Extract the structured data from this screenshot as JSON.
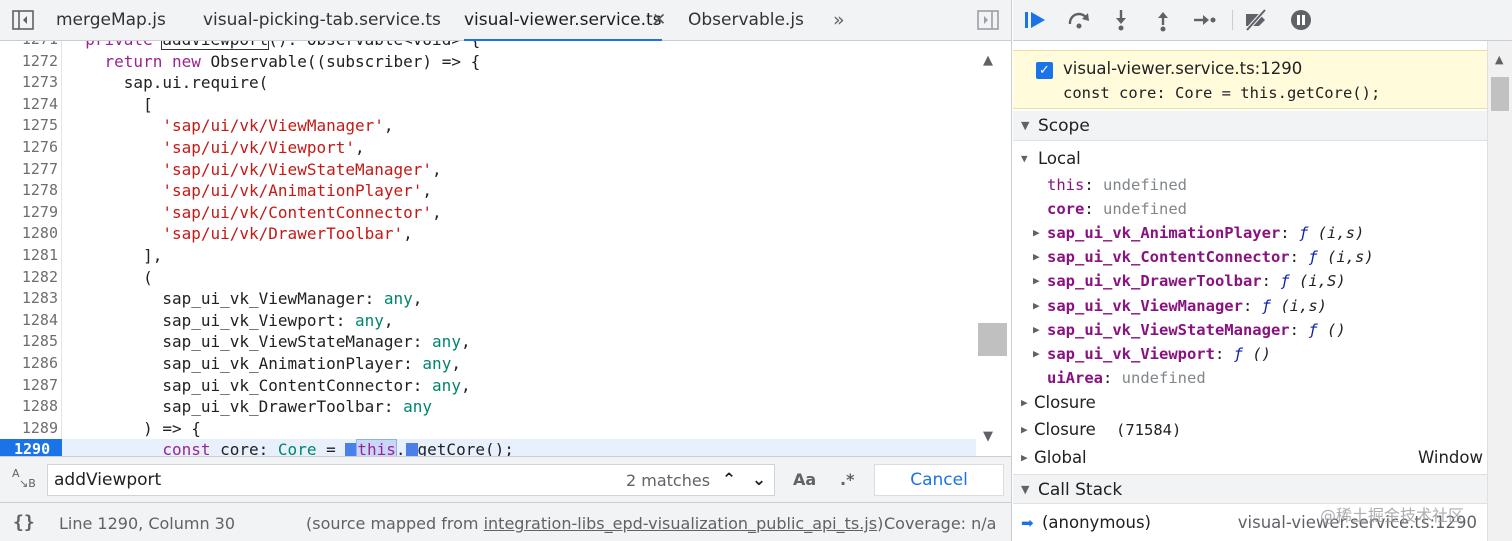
{
  "tabs": [
    {
      "label": "mergeMap.js"
    },
    {
      "label": "visual-picking-tab.service.ts"
    },
    {
      "label": "visual-viewer.service.ts"
    },
    {
      "label": "Observable.js"
    }
  ],
  "tab_close": "✕",
  "tab_more": "»",
  "code": {
    "lines": [
      {
        "n": "1271",
        "segs": [
          {
            "t": "  "
          },
          {
            "t": "private ",
            "c": "kw"
          },
          {
            "t": "addViewport",
            "c": "hlbox"
          },
          {
            "t": "(): Observable<void> {"
          }
        ]
      },
      {
        "n": "1272",
        "segs": [
          {
            "t": "    "
          },
          {
            "t": "return new ",
            "c": "kw"
          },
          {
            "t": "Observable((subscriber) => {"
          }
        ]
      },
      {
        "n": "1273",
        "segs": [
          {
            "t": "      sap.ui.require("
          }
        ]
      },
      {
        "n": "1274",
        "segs": [
          {
            "t": "        ["
          }
        ]
      },
      {
        "n": "1275",
        "segs": [
          {
            "t": "          "
          },
          {
            "t": "'sap/ui/vk/ViewManager'",
            "c": "str"
          },
          {
            "t": ","
          }
        ]
      },
      {
        "n": "1276",
        "segs": [
          {
            "t": "          "
          },
          {
            "t": "'sap/ui/vk/Viewport'",
            "c": "str"
          },
          {
            "t": ","
          }
        ]
      },
      {
        "n": "1277",
        "segs": [
          {
            "t": "          "
          },
          {
            "t": "'sap/ui/vk/ViewStateManager'",
            "c": "str"
          },
          {
            "t": ","
          }
        ]
      },
      {
        "n": "1278",
        "segs": [
          {
            "t": "          "
          },
          {
            "t": "'sap/ui/vk/AnimationPlayer'",
            "c": "str"
          },
          {
            "t": ","
          }
        ]
      },
      {
        "n": "1279",
        "segs": [
          {
            "t": "          "
          },
          {
            "t": "'sap/ui/vk/ContentConnector'",
            "c": "str"
          },
          {
            "t": ","
          }
        ]
      },
      {
        "n": "1280",
        "segs": [
          {
            "t": "          "
          },
          {
            "t": "'sap/ui/vk/DrawerToolbar'",
            "c": "str"
          },
          {
            "t": ","
          }
        ]
      },
      {
        "n": "1281",
        "segs": [
          {
            "t": "        ],"
          }
        ]
      },
      {
        "n": "1282",
        "segs": [
          {
            "t": "        ("
          }
        ]
      },
      {
        "n": "1283",
        "segs": [
          {
            "t": "          sap_ui_vk_ViewManager: "
          },
          {
            "t": "any",
            "c": "ty"
          },
          {
            "t": ","
          }
        ]
      },
      {
        "n": "1284",
        "segs": [
          {
            "t": "          sap_ui_vk_Viewport: "
          },
          {
            "t": "any",
            "c": "ty"
          },
          {
            "t": ","
          }
        ]
      },
      {
        "n": "1285",
        "segs": [
          {
            "t": "          sap_ui_vk_ViewStateManager: "
          },
          {
            "t": "any",
            "c": "ty"
          },
          {
            "t": ","
          }
        ]
      },
      {
        "n": "1286",
        "segs": [
          {
            "t": "          sap_ui_vk_AnimationPlayer: "
          },
          {
            "t": "any",
            "c": "ty"
          },
          {
            "t": ","
          }
        ]
      },
      {
        "n": "1287",
        "segs": [
          {
            "t": "          sap_ui_vk_ContentConnector: "
          },
          {
            "t": "any",
            "c": "ty"
          },
          {
            "t": ","
          }
        ]
      },
      {
        "n": "1288",
        "segs": [
          {
            "t": "          sap_ui_vk_DrawerToolbar: "
          },
          {
            "t": "any",
            "c": "ty"
          }
        ]
      },
      {
        "n": "1289",
        "segs": [
          {
            "t": "        ) => {"
          }
        ]
      },
      {
        "n": "1290",
        "current": true,
        "segs": [
          {
            "t": "          "
          },
          {
            "t": "const ",
            "c": "kw"
          },
          {
            "t": "core: "
          },
          {
            "t": "Core",
            "c": "ty"
          },
          {
            "t": " = "
          },
          {
            "t": "",
            "c": "bpm"
          },
          {
            "t": "this",
            "c": "kwhl"
          },
          {
            "t": "."
          },
          {
            "t": "",
            "c": "bpm"
          },
          {
            "t": "getCore();"
          }
        ]
      }
    ]
  },
  "search": {
    "value": "addViewport",
    "matches": "2 matches",
    "match_case": "Aa",
    "regex": ".*",
    "cancel": "Cancel"
  },
  "status": {
    "pretty_print": "{}",
    "cursor": "Line 1290, Column 30",
    "source_map_prefix": "(source mapped from ",
    "source_map_file": "integration-libs_epd-visualization_public_api_ts.js",
    "source_map_suffix": ")",
    "coverage": "Coverage: n/a"
  },
  "breakpoint": {
    "location": "visual-viewer.service.ts:1290",
    "code": "const core: Core = this.getCore();"
  },
  "scope": {
    "header": "Scope",
    "local_label": "Local",
    "local_items": [
      {
        "name": "this",
        "value": "undefined",
        "kind": "undef",
        "expandable": false
      },
      {
        "name": "core",
        "value": "undefined",
        "kind": "undef",
        "expandable": false
      },
      {
        "name": "sap_ui_vk_AnimationPlayer",
        "value": "(i,s)",
        "kind": "fn",
        "expandable": true
      },
      {
        "name": "sap_ui_vk_ContentConnector",
        "value": "(i,s)",
        "kind": "fn",
        "expandable": true
      },
      {
        "name": "sap_ui_vk_DrawerToolbar",
        "value": "(i,S)",
        "kind": "fn",
        "expandable": true
      },
      {
        "name": "sap_ui_vk_ViewManager",
        "value": "(i,s)",
        "kind": "fn",
        "expandable": true
      },
      {
        "name": "sap_ui_vk_ViewStateManager",
        "value": "()",
        "kind": "fn",
        "expandable": true
      },
      {
        "name": "sap_ui_vk_Viewport",
        "value": "()",
        "kind": "fn",
        "expandable": true
      },
      {
        "name": "uiArea",
        "value": "undefined",
        "kind": "undef",
        "expandable": false
      }
    ],
    "closure_label": "Closure",
    "closure2_label": "Closure",
    "closure2_id": "(71584)",
    "global_label": "Global",
    "global_value": "Window",
    "fn_glyph": "ƒ"
  },
  "callstack": {
    "header": "Call Stack",
    "fn": "(anonymous)",
    "location": "visual-viewer.service.ts:1290"
  },
  "watermark": "@稀土掘金技术社区",
  "colors": {
    "accent": "#1a73e8",
    "keyword": "#9b2393",
    "string": "#c41a16",
    "type": "#00846c",
    "breakpoint_bg": "#fffbdb"
  }
}
